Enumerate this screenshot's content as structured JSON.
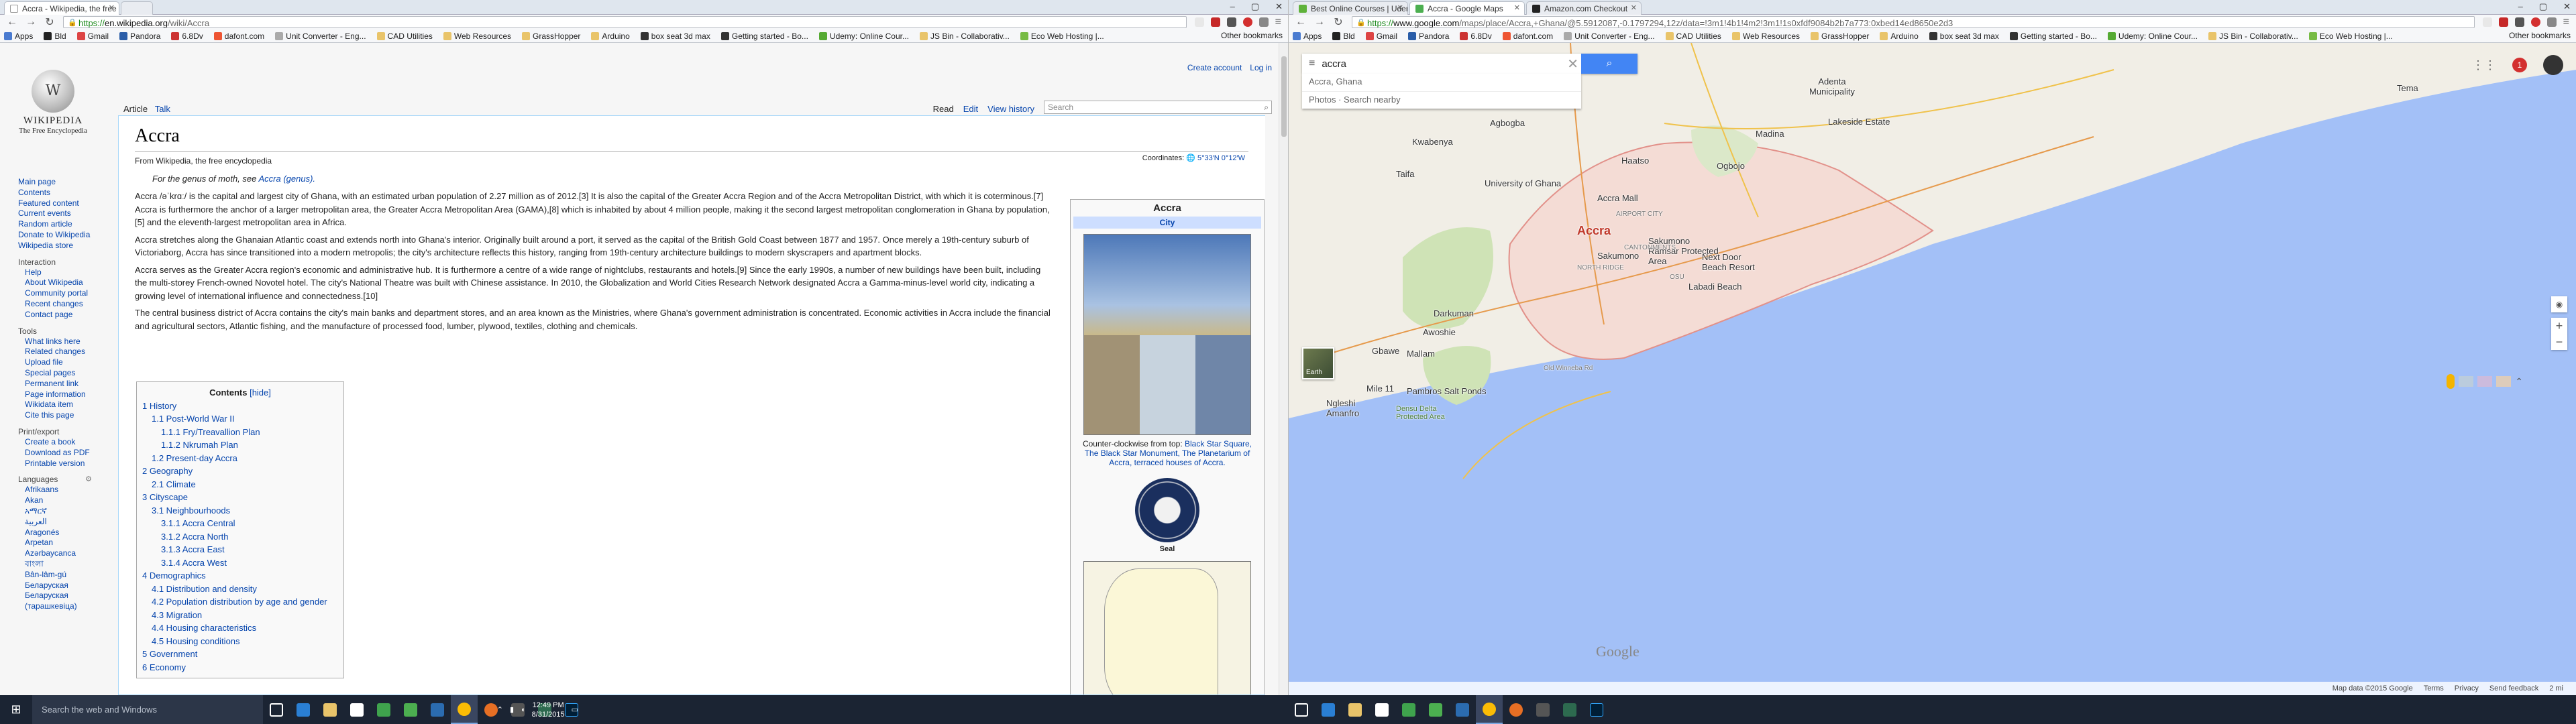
{
  "left": {
    "tabs": [
      {
        "title": "Accra - Wikipedia, the free",
        "active": true
      },
      {
        "title": "",
        "active": false
      }
    ],
    "url": {
      "scheme": "https://",
      "host": "en.wikipedia.org",
      "path": "/wiki/Accra"
    },
    "bookmarks": [
      "Apps",
      "Bld",
      "Gmail",
      "Pandora",
      "6.8Dv",
      "dafont.com",
      "Unit Converter - Eng...",
      "CAD Utilities",
      "Web Resources",
      "GrassHopper",
      "Arduino",
      "box seat 3d max",
      "Getting started - Bo...",
      "Udemy: Online Cour...",
      "JS Bin - Collaborativ...",
      "Eco Web Hosting |..."
    ],
    "other_bookmarks": "Other bookmarks",
    "wiki": {
      "logo_title": "WIKIPEDIA",
      "logo_sub": "The Free Encyclopedia",
      "nav": [
        "Main page",
        "Contents",
        "Featured content",
        "Current events",
        "Random article",
        "Donate to Wikipedia",
        "Wikipedia store"
      ],
      "interaction_head": "Interaction",
      "interaction": [
        "Help",
        "About Wikipedia",
        "Community portal",
        "Recent changes",
        "Contact page"
      ],
      "tools_head": "Tools",
      "tools": [
        "What links here",
        "Related changes",
        "Upload file",
        "Special pages",
        "Permanent link",
        "Page information",
        "Wikidata item",
        "Cite this page"
      ],
      "print_head": "Print/export",
      "print": [
        "Create a book",
        "Download as PDF",
        "Printable version"
      ],
      "lang_head": "Languages",
      "langs": [
        "Afrikaans",
        "Akan",
        "አማርኛ",
        "العربية",
        "Aragonés",
        "Arpetan",
        "Azərbaycanca",
        "বাংলা",
        "Bân-lâm-gú",
        "Беларуская",
        "Беларуская (тарашкевіца)"
      ],
      "tab_article": "Article",
      "tab_talk": "Talk",
      "tab_read": "Read",
      "tab_edit": "Edit",
      "tab_history": "View history",
      "search_placeholder": "Search",
      "create_account": "Create account",
      "log_in": "Log in",
      "title": "Accra",
      "from": "From Wikipedia, the free encyclopedia",
      "coords_label": "Coordinates:",
      "coords": "5°33′N 0°12′W",
      "hatnote_pre": "For the genus of moth, see",
      "hatnote_link": "Accra (genus).",
      "para1": "Accra /əˈkrɑː/ is the capital and largest city of Ghana, with an estimated urban population of 2.27 million as of 2012.[3] It is also the capital of the Greater Accra Region and of the Accra Metropolitan District, with which it is coterminous.[7] Accra is furthermore the anchor of a larger metropolitan area, the Greater Accra Metropolitan Area (GAMA),[8] which is inhabited by about 4 million people, making it the second largest metropolitan conglomeration in Ghana by population,[5] and the eleventh-largest metropolitan area in Africa.",
      "para2": "Accra stretches along the Ghanaian Atlantic coast and extends north into Ghana's interior. Originally built around a port, it served as the capital of the British Gold Coast between 1877 and 1957. Once merely a 19th-century suburb of Victoriaborg, Accra has since transitioned into a modern metropolis; the city's architecture reflects this history, ranging from 19th-century architecture buildings to modern skyscrapers and apartment blocks.",
      "para3": "Accra serves as the Greater Accra region's economic and administrative hub. It is furthermore a centre of a wide range of nightclubs, restaurants and hotels.[9] Since the early 1990s, a number of new buildings have been built, including the multi-storey French-owned Novotel hotel. The city's National Theatre was built with Chinese assistance. In 2010, the Globalization and World Cities Research Network designated Accra a Gamma-minus-level world city, indicating a growing level of international influence and connectedness.[10]",
      "para4": "The central business district of Accra contains the city's main banks and department stores, and an area known as the Ministries, where Ghana's government administration is concentrated. Economic activities in Accra include the financial and agricultural sectors, Atlantic fishing, and the manufacture of processed food, lumber, plywood, textiles, clothing and chemicals.",
      "toc_title": "Contents",
      "toc_hide": "[hide]",
      "toc": [
        {
          "t": "1 History",
          "lvl": 1
        },
        {
          "t": "1.1 Post-World War II",
          "lvl": 2
        },
        {
          "t": "1.1.1 Fry/Treavallion Plan",
          "lvl": 3
        },
        {
          "t": "1.1.2 Nkrumah Plan",
          "lvl": 3
        },
        {
          "t": "1.2 Present-day Accra",
          "lvl": 2
        },
        {
          "t": "2 Geography",
          "lvl": 1
        },
        {
          "t": "2.1 Climate",
          "lvl": 2
        },
        {
          "t": "3 Cityscape",
          "lvl": 1
        },
        {
          "t": "3.1 Neighbourhoods",
          "lvl": 2
        },
        {
          "t": "3.1.1 Accra Central",
          "lvl": 3
        },
        {
          "t": "3.1.2 Accra North",
          "lvl": 3
        },
        {
          "t": "3.1.3 Accra East",
          "lvl": 3
        },
        {
          "t": "3.1.4 Accra West",
          "lvl": 3
        },
        {
          "t": "4 Demographics",
          "lvl": 1
        },
        {
          "t": "4.1 Distribution and density",
          "lvl": 2
        },
        {
          "t": "4.2 Population distribution by age and gender",
          "lvl": 2
        },
        {
          "t": "4.3 Migration",
          "lvl": 2
        },
        {
          "t": "4.4 Housing characteristics",
          "lvl": 2
        },
        {
          "t": "4.5 Housing conditions",
          "lvl": 2
        },
        {
          "t": "5 Government",
          "lvl": 1
        },
        {
          "t": "6 Economy",
          "lvl": 1
        }
      ],
      "infobox_title": "Accra",
      "infobox_type": "City",
      "infobox_caption_pre": "Counter-clockwise from top:",
      "infobox_caption": "Black Star Square, The Black Star Monument, The Planetarium of Accra, terraced houses of Accra.",
      "infobox_seal": "Seal"
    }
  },
  "right": {
    "tabs": [
      {
        "title": "Best Online Courses | Udem",
        "active": false
      },
      {
        "title": "Accra - Google Maps",
        "active": true
      },
      {
        "title": "Amazon.com Checkout",
        "active": false
      }
    ],
    "url": {
      "scheme": "https://",
      "host": "www.google.com",
      "path": "/maps/place/Accra,+Ghana/@5.5912087,-0.1797294,12z/data=!3m1!4b1!4m2!3m1!1s0xfdf9084b2b7a773:0xbed14ed8650e2d3"
    },
    "bookmarks": [
      "Apps",
      "Bld",
      "Gmail",
      "Pandora",
      "6.8Dv",
      "dafont.com",
      "Unit Converter - Eng...",
      "CAD Utilities",
      "Web Resources",
      "GrassHopper",
      "Arduino",
      "box seat 3d max",
      "Getting started - Bo...",
      "Udemy: Online Cour...",
      "JS Bin - Collaborativ...",
      "Eco Web Hosting |..."
    ],
    "other_bookmarks": "Other bookmarks",
    "maps": {
      "search_value": "accra",
      "suggestions": [
        "Accra, Ghana",
        "Photos · Search nearby"
      ],
      "notifications": "1",
      "earth_label": "Earth",
      "google_logo": "Google",
      "footer": [
        "Map data ©2015 Google",
        "Terms",
        "Privacy",
        "Send feedback",
        "2 mi"
      ],
      "places": [
        {
          "name": "Accra",
          "cls": "big"
        },
        {
          "name": "Tema",
          "cls": ""
        },
        {
          "name": "Adenta Municipality",
          "cls": ""
        },
        {
          "name": "Madina",
          "cls": ""
        },
        {
          "name": "Lakeside Estate",
          "cls": ""
        },
        {
          "name": "Agbogba",
          "cls": ""
        },
        {
          "name": "Kwabenya",
          "cls": ""
        },
        {
          "name": "Haatso",
          "cls": ""
        },
        {
          "name": "Ogbojo",
          "cls": ""
        },
        {
          "name": "Taifa",
          "cls": ""
        },
        {
          "name": "University of Ghana",
          "cls": ""
        },
        {
          "name": "Sakumono Ramsar Protected Area",
          "cls": ""
        },
        {
          "name": "Sakumono",
          "cls": ""
        },
        {
          "name": "Accra Mall",
          "cls": ""
        },
        {
          "name": "Darkuman",
          "cls": ""
        },
        {
          "name": "Awoshie",
          "cls": ""
        },
        {
          "name": "Gbawe",
          "cls": ""
        },
        {
          "name": "Mallam",
          "cls": ""
        },
        {
          "name": "Next Door Beach Resort",
          "cls": ""
        },
        {
          "name": "Labadi Beach",
          "cls": ""
        },
        {
          "name": "Mile 11",
          "cls": ""
        },
        {
          "name": "Pambros Salt Ponds",
          "cls": ""
        },
        {
          "name": "Densu Delta Protected Area",
          "cls": ""
        },
        {
          "name": "Ngleshi Amanfro",
          "cls": ""
        },
        {
          "name": "Old Winneba Rd",
          "cls": "sm"
        },
        {
          "name": "AIRPORT CITY",
          "cls": "sm"
        },
        {
          "name": "CANTONMENTS",
          "cls": "sm"
        },
        {
          "name": "OSU",
          "cls": "sm"
        },
        {
          "name": "NORTH RIDGE",
          "cls": "sm"
        }
      ]
    }
  },
  "taskbar": {
    "search_placeholder": "Search the web and Windows",
    "time": "12:49 PM",
    "date": "8/31/2015"
  },
  "colors": {
    "wiki_link": "#0645ad",
    "maps_blue": "#4285f4",
    "water": "#a3c0f7",
    "city_area": "#f4dcd5",
    "park": "#cfe3b6"
  }
}
